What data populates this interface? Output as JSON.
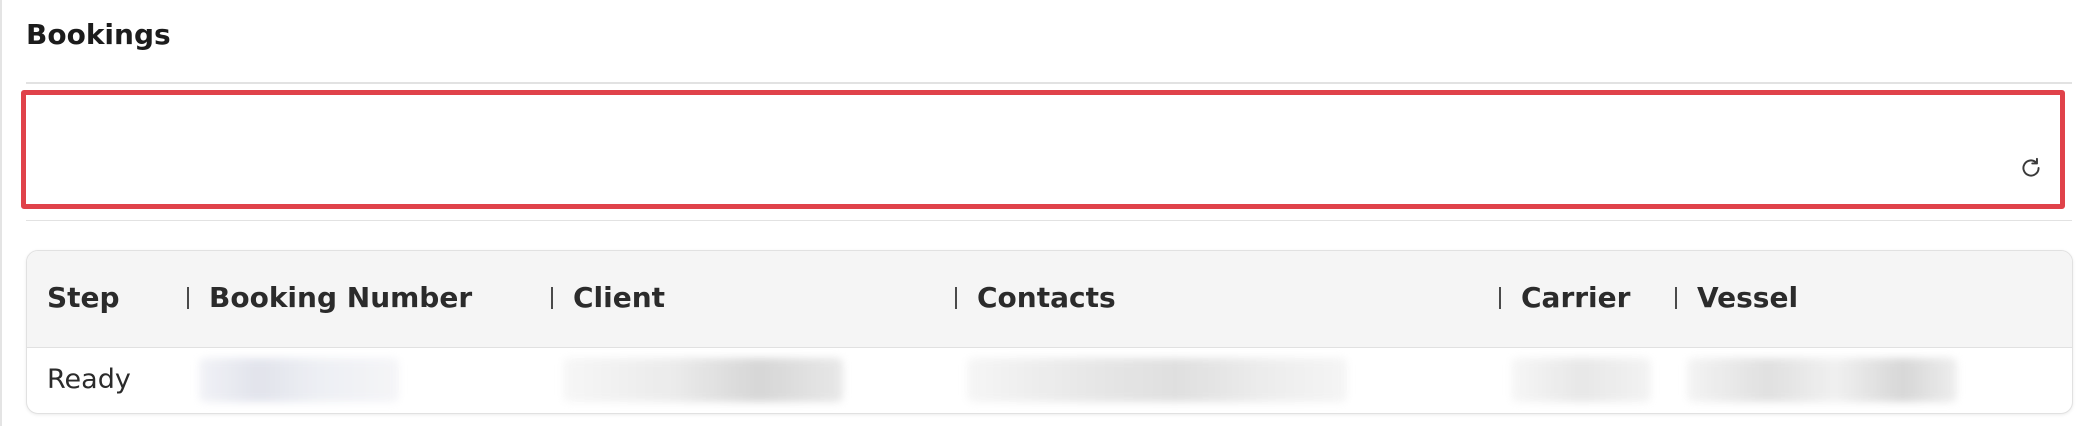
{
  "page": {
    "title": "Bookings"
  },
  "filter": {
    "refresh_icon": "refresh-icon"
  },
  "colors": {
    "highlight": "#e0424a",
    "header_bg": "#f5f5f5"
  },
  "table": {
    "columns": [
      "Step",
      "Booking Number",
      "Client",
      "Contacts",
      "Carrier",
      "Vessel"
    ],
    "rows": [
      {
        "step": "Ready"
      }
    ]
  }
}
